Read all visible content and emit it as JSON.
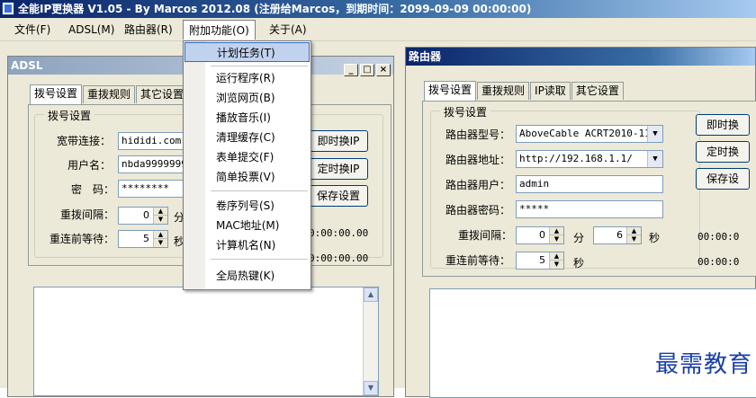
{
  "window": {
    "title": "全能IP更换器 V1.05 - By Marcos 2012.08 (注册给Marcos，到期时间：2099-09-09 00:00:00)"
  },
  "menubar": {
    "items": [
      "文件(F)",
      "ADSL(M)",
      "路由器(R)",
      "附加功能(O)",
      "关于(A)"
    ]
  },
  "dropdown": {
    "items": [
      "计划任务(T)",
      "运行程序(R)",
      "浏览网页(B)",
      "播放音乐(I)",
      "清理缓存(C)",
      "表单提交(F)",
      "简单投票(V)",
      "卷序列号(S)",
      "MAC地址(M)",
      "计算机名(N)",
      "全局热键(K)"
    ]
  },
  "adsl": {
    "title": "ADSL",
    "caption_buttons": [
      "_",
      "□",
      "×"
    ],
    "tabs": [
      "拨号设置",
      "重拨规则",
      "其它设置"
    ],
    "group_label": "拨号设置",
    "labels": {
      "connection": "宽带连接：",
      "username": "用户名：",
      "password": "密　码：",
      "redial_interval": "重拨间隔：",
      "wait_before": "重连前等待："
    },
    "values": {
      "connection": "hididi.com",
      "username": "nbda9999999",
      "password": "********",
      "redial_interval": "0",
      "wait_before": "5"
    },
    "units": {
      "minute": "分",
      "second": "秒"
    },
    "buttons": [
      "即时换IP",
      "定时换IP",
      "保存设置"
    ],
    "timer_text": "0:00:00.00"
  },
  "router": {
    "title": "路由器",
    "tabs": [
      "拨号设置",
      "重拨规则",
      "IP读取",
      "其它设置"
    ],
    "group_label": "拨号设置",
    "labels": {
      "model": "路由器型号：",
      "address": "路由器地址：",
      "user": "路由器用户：",
      "password": "路由器密码：",
      "redial_interval": "重拨间隔：",
      "wait_before": "重连前等待："
    },
    "values": {
      "model": "AboveCable ACRT2010-11",
      "address": "http://192.168.1.1/",
      "user": "admin",
      "password": "*****",
      "redial_minutes": "0",
      "redial_seconds": "6",
      "wait_before": "5"
    },
    "units": {
      "minute": "分",
      "second": "秒"
    },
    "buttons": [
      "即时换",
      "定时换",
      "保存设"
    ],
    "timer_text": "00:00:0"
  },
  "watermark": "最需教育"
}
